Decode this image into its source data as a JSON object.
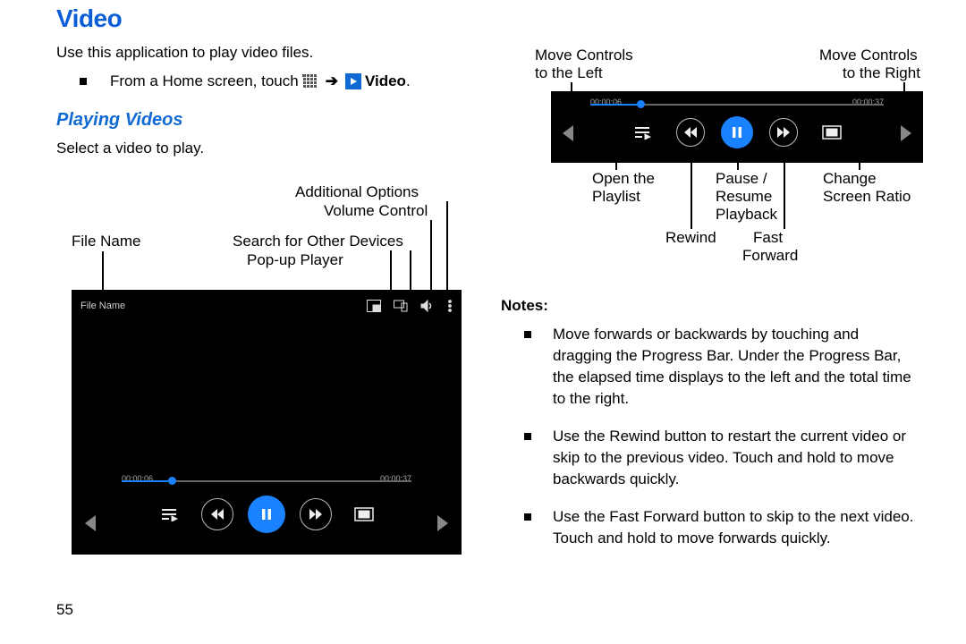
{
  "page_number": "55",
  "heading": "Video",
  "intro": "Use this application to play video files.",
  "home_instr_prefix": "From a Home screen, touch",
  "home_instr_video": "Video",
  "home_instr_period": ".",
  "playing_heading": "Playing Videos",
  "select_text": "Select a video to play.",
  "callouts_left": {
    "file_name": "File Name",
    "additional_options": "Additional Options",
    "volume_control": "Volume Control",
    "search_devices": "Search for Other Devices",
    "popup_player": "Pop-up Player"
  },
  "callouts_zoom": {
    "move_left_l1": "Move Controls",
    "move_left_l2": "to the Left",
    "move_right_l1": "Move Controls",
    "move_right_l2": "to the Right",
    "open_playlist_l1": "Open the",
    "open_playlist_l2": "Playlist",
    "pause_l1": "Pause /",
    "pause_l2": "Resume",
    "pause_l3": "Playback",
    "change_l1": "Change",
    "change_l2": "Screen Ratio",
    "rewind": "Rewind",
    "ff_l1": "Fast",
    "ff_l2": "Forward"
  },
  "player": {
    "file_label": "File Name",
    "elapsed": "00:00:06",
    "total": "00:00:37",
    "progress_pct": 16
  },
  "notes_heading": "Notes:",
  "notes": [
    "Move forwards or backwards by touching and dragging the Progress Bar. Under the Progress Bar, the elapsed time displays to the left and the total time to the right.",
    "Use the Rewind button to restart the current video or skip to the previous video. Touch and hold to move backwards quickly.",
    "Use the Fast Forward button to skip to the next video. Touch and hold to move forwards quickly."
  ]
}
